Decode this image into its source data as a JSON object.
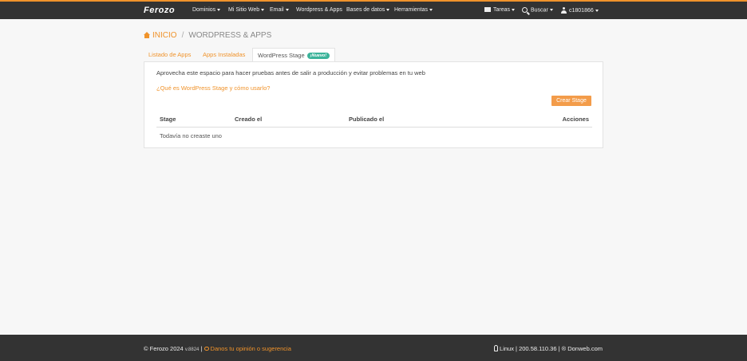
{
  "navbar": {
    "brand": "Ferozo",
    "items": [
      {
        "label": "Dominios"
      },
      {
        "label": "Mi Sitio Web"
      },
      {
        "label": "Email"
      },
      {
        "label": "Wordpress & Apps"
      },
      {
        "label": "Bases de datos"
      },
      {
        "label": "Herramientas"
      }
    ],
    "tareas": "Tareas",
    "buscar": "Buscar",
    "user": "c1801866"
  },
  "breadcrumb": {
    "home": "INICIO",
    "separator": "/",
    "current": "WORDPRESS & APPS"
  },
  "tabs": [
    {
      "label": "Listado de Apps"
    },
    {
      "label": "Apps Instaladas"
    },
    {
      "label": "WordPress Stage",
      "badge": "¡Nuevo!"
    }
  ],
  "panel": {
    "description": "Aprovecha este espacio para hacer pruebas antes de salir a producción y evitar problemas en tu web",
    "help_link": "¿Qué es WordPress Stage y cómo usarlo?",
    "create_button": "Crear Stage",
    "table": {
      "headers": [
        "Stage",
        "Creado el",
        "Publicado el",
        "Acciones"
      ],
      "empty_text": "Todavía no creaste uno"
    }
  },
  "footer": {
    "copyright": "© Ferozo 2024",
    "version": "v.8824",
    "divider": "|",
    "feedback": "Danos tu opinión o sugerencia",
    "server": "Linux | 200.58.110.36 | ® Donweb.com"
  },
  "colors": {
    "accent": "#f0932b",
    "navbar": "#333333",
    "badge": "#3bb39a"
  }
}
